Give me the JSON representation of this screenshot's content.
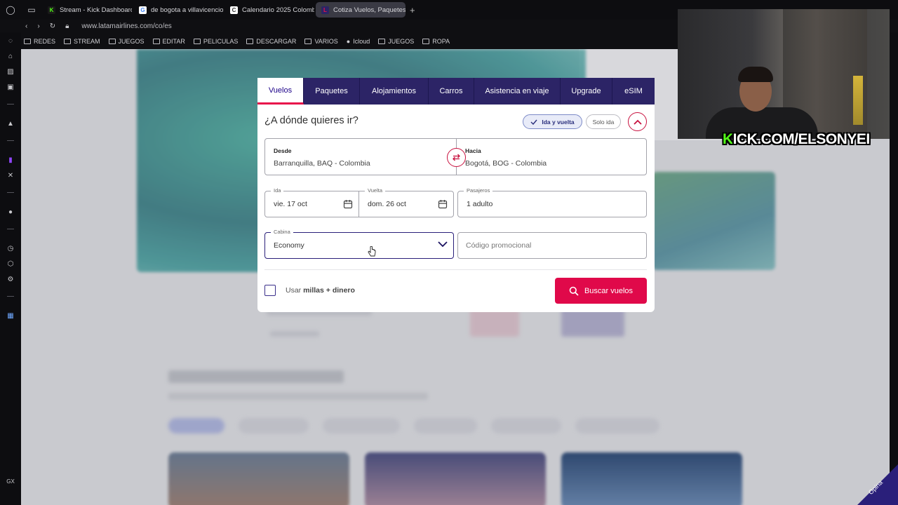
{
  "browser": {
    "tabs": [
      {
        "title": "Stream - Kick Dashboard",
        "fav": "K",
        "fav_color": "#53fc18",
        "active": false
      },
      {
        "title": "de bogota a villavicencio",
        "fav": "G",
        "fav_color": "#ffffff",
        "active": false
      },
      {
        "title": "Calendario 2025 Colomb",
        "fav": "C",
        "fav_color": "#ffffff",
        "active": false
      },
      {
        "title": "Cotiza Vuelos, Paquetes,",
        "fav": "L",
        "fav_color": "#e8114b",
        "active": true
      }
    ],
    "url": "www.latamairlines.com/co/es",
    "bookmarks": [
      "REDES",
      "STREAM",
      "JUEGOS",
      "EDITAR",
      "PELICULAS",
      "DESCARGAR",
      "VARIOS",
      "Icloud",
      "JUEGOS",
      "ROPA"
    ],
    "sidebar_bottom": "GX"
  },
  "widget": {
    "tabs": [
      "Vuelos",
      "Paquetes",
      "Alojamientos",
      "Carros",
      "Asistencia en viaje",
      "Upgrade",
      "eSIM"
    ],
    "question": "¿A dónde quieres ir?",
    "trip_roundtrip": "Ida y vuelta",
    "trip_oneway": "Solo ida",
    "from_label": "Desde",
    "from_value": "Barranquilla, BAQ - Colombia",
    "to_label": "Hacia",
    "to_value": "Bogotá, BOG - Colombia",
    "depart_label": "Ida",
    "depart_value": "vie. 17 oct",
    "return_label": "Vuelta",
    "return_value": "dom. 26 oct",
    "pax_label": "Pasajeros",
    "pax_value": "1 adulto",
    "cabin_label": "Cabina",
    "cabin_value": "Economy",
    "promo_placeholder": "Código promocional",
    "miles_prefix": "Usar",
    "miles_bold": "millas + dinero",
    "search_label": "Buscar vuelos"
  },
  "overlay": {
    "kick_prefix": "K",
    "kick_rest": "ICK.COM/ELSONYEI",
    "opina": "Opina"
  },
  "colors": {
    "brand_navy": "#2c2466",
    "brand_red": "#e0094a",
    "kick_green": "#53fc18"
  }
}
